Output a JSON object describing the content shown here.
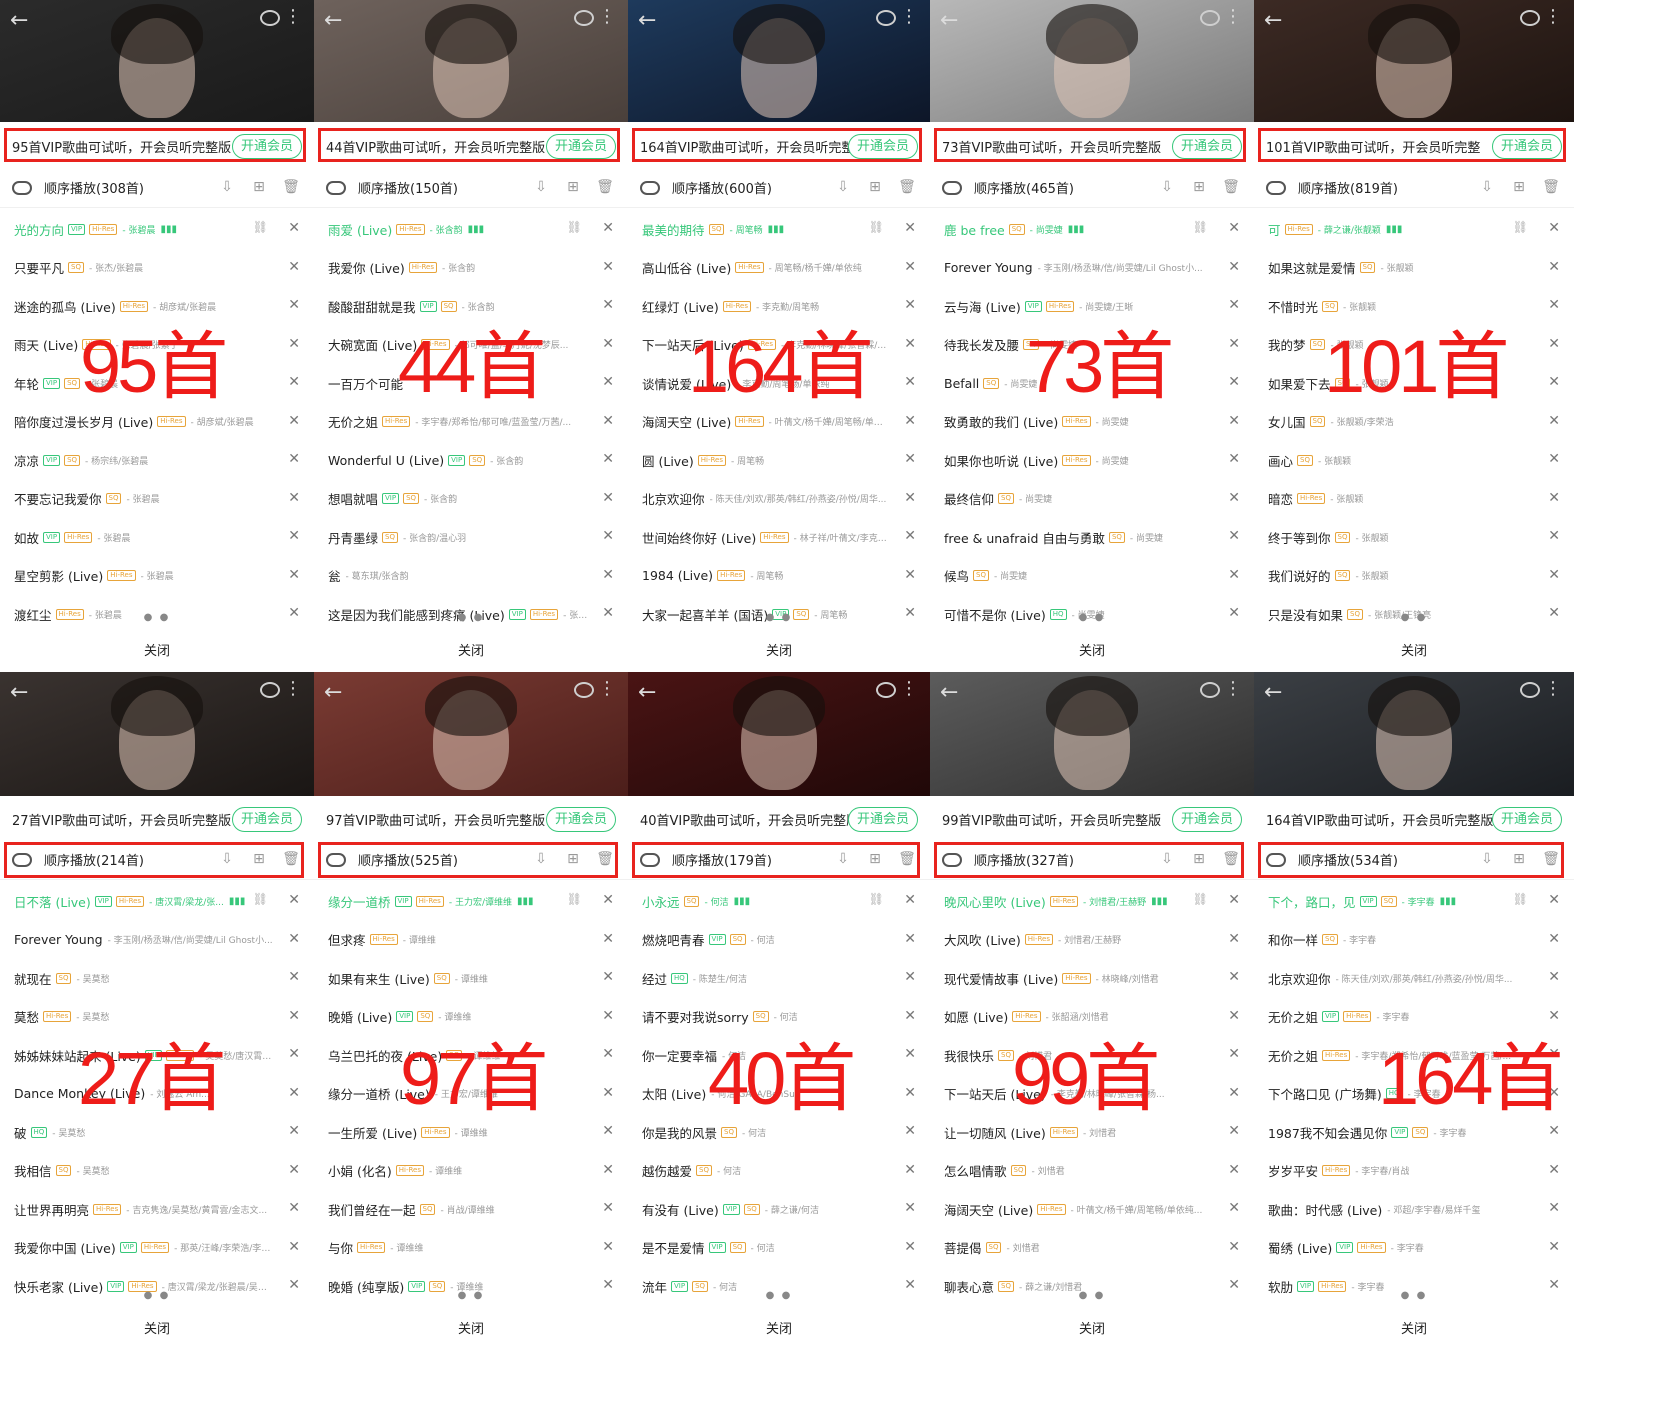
{
  "common": {
    "close_label": "关闭",
    "vip_button": "开通会员",
    "page_dots": "● ●",
    "icons": {
      "back": "back-arrow-icon",
      "comment": "comment-icon",
      "more": "more-icon",
      "shuffle": "loop-icon",
      "download": "download-icon",
      "add": "add-to-playlist-icon",
      "delete": "trash-icon",
      "link": "link-icon",
      "remove": "close-icon",
      "playing": "equalizer-icon"
    },
    "accent_color": "#37c77a",
    "highlight_color": "#ee1c19"
  },
  "panels": [
    {
      "vip_text": "95首VIP歌曲可试听，开会员听完整版",
      "play_label": "顺序播放(308首)",
      "big_label": "95首",
      "songs": [
        {
          "title": "光的方向",
          "tags": [
            "VIP",
            "Hi-Res"
          ],
          "artist": "张碧晨",
          "active": true
        },
        {
          "title": "只要平凡",
          "tags": [
            "SQ"
          ],
          "artist": "张杰/张碧晨"
        },
        {
          "title": "迷途的孤鸟 (Live)",
          "tags": [
            "Hi-Res"
          ],
          "artist": "胡彦斌/张碧晨"
        },
        {
          "title": "雨天 (Live)",
          "tags": [
            "Hi-Res"
          ],
          "artist": "张碧晨/张紫宁"
        },
        {
          "title": "年轮",
          "tags": [
            "VIP",
            "SQ"
          ],
          "artist": "张碧晨"
        },
        {
          "title": "陪你度过漫长岁月 (Live)",
          "tags": [
            "Hi-Res"
          ],
          "artist": "胡彦斌/张碧晨"
        },
        {
          "title": "凉凉",
          "tags": [
            "VIP",
            "SQ"
          ],
          "artist": "杨宗纬/张碧晨"
        },
        {
          "title": "不要忘记我爱你",
          "tags": [
            "SQ"
          ],
          "artist": "张碧晨"
        },
        {
          "title": "如故",
          "tags": [
            "VIP",
            "Hi-Res"
          ],
          "artist": "张碧晨"
        },
        {
          "title": "星空剪影 (Live)",
          "tags": [
            "Hi-Res"
          ],
          "artist": "张碧晨"
        },
        {
          "title": "渡红尘",
          "tags": [
            "Hi-Res"
          ],
          "artist": "张碧晨"
        }
      ]
    },
    {
      "vip_text": "44首VIP歌曲可试听，开会员听完整版",
      "play_label": "顺序播放(150首)",
      "big_label": "44首",
      "songs": [
        {
          "title": "雨爱 (Live)",
          "tags": [
            "Hi-Res"
          ],
          "artist": "张含韵",
          "active": true
        },
        {
          "title": "我爱你 (Live)",
          "tags": [
            "Hi-Res"
          ],
          "artist": "张含韵"
        },
        {
          "title": "酸酸甜甜就是我",
          "tags": [
            "VIP",
            "SQ"
          ],
          "artist": "张含韵"
        },
        {
          "title": "大碗宽面 (Live)",
          "tags": [
            "Hi-Res"
          ],
          "artist": "郁可唯/孟/李丹妮/沈梦辰..."
        },
        {
          "title": "一百万个可能",
          "tags": [],
          "artist": ""
        },
        {
          "title": "无价之姐",
          "tags": [
            "Hi-Res"
          ],
          "artist": "李宇春/郑希怡/郁可唯/蓝盈莹/万茜/..."
        },
        {
          "title": "Wonderful U (Live)",
          "tags": [
            "VIP",
            "SQ"
          ],
          "artist": "张含韵"
        },
        {
          "title": "想唱就唱",
          "tags": [
            "VIP",
            "SQ"
          ],
          "artist": "张含韵"
        },
        {
          "title": "丹青墨绿",
          "tags": [
            "SQ"
          ],
          "artist": "张含韵/温心羽"
        },
        {
          "title": "瓮",
          "tags": [],
          "artist": "葛东琪/张含韵"
        },
        {
          "title": "这是因为我们能感到疼痛 (Live)",
          "tags": [
            "VIP",
            "Hi-Res"
          ],
          "artist": "张含韵..."
        }
      ]
    },
    {
      "vip_text": "164首VIP歌曲可试听，开会员听完整版",
      "play_label": "顺序播放(600首)",
      "big_label": "164首",
      "songs": [
        {
          "title": "最美的期待",
          "tags": [
            "SQ"
          ],
          "artist": "周笔畅",
          "active": true
        },
        {
          "title": "高山低谷 (Live)",
          "tags": [
            "Hi-Res"
          ],
          "artist": "周笔畅/杨千嬅/单依纯"
        },
        {
          "title": "红绿灯 (Live)",
          "tags": [
            "Hi-Res"
          ],
          "artist": "李克勤/周笔畅"
        },
        {
          "title": "下一站天后 (Live)",
          "tags": [
            "Hi-Res"
          ],
          "artist": "李克勤/林晓峰/张智霖/杨..."
        },
        {
          "title": "谈情说爱 (Live)",
          "tags": [],
          "artist": "李克勤/周笔畅/单依纯"
        },
        {
          "title": "海阔天空 (Live)",
          "tags": [
            "Hi-Res"
          ],
          "artist": "叶蒨文/杨千嬅/周笔畅/单依纯..."
        },
        {
          "title": "圆 (Live)",
          "tags": [
            "Hi-Res"
          ],
          "artist": "周笔畅"
        },
        {
          "title": "北京欢迎你",
          "tags": [],
          "artist": "陈天佳/刘欢/那英/韩红/孙燕姿/孙悦/周华..."
        },
        {
          "title": "世间始终你好 (Live)",
          "tags": [
            "Hi-Res"
          ],
          "artist": "林子祥/叶蒨文/李克勤/..."
        },
        {
          "title": "1984 (Live)",
          "tags": [
            "Hi-Res"
          ],
          "artist": "周笔畅"
        },
        {
          "title": "大家一起喜羊羊 (国语)",
          "tags": [
            "VIP",
            "SQ"
          ],
          "artist": "周笔畅"
        }
      ]
    },
    {
      "vip_text": "73首VIP歌曲可试听，开会员听完整版",
      "play_label": "顺序播放(465首)",
      "big_label": "73首",
      "songs": [
        {
          "title": "鹿 be free",
          "tags": [
            "SQ"
          ],
          "artist": "尚雯婕",
          "active": true
        },
        {
          "title": "Forever Young",
          "tags": [],
          "artist": "李玉刚/杨丞琳/信/尚雯婕/Lil Ghost小..."
        },
        {
          "title": "云与海 (Live)",
          "tags": [
            "VIP",
            "Hi-Res"
          ],
          "artist": "尚雯婕/王晰"
        },
        {
          "title": "待我长发及腰",
          "tags": [
            "SQ"
          ],
          "artist": "尚雯婕"
        },
        {
          "title": "Befall",
          "tags": [
            "SQ"
          ],
          "artist": "尚雯婕"
        },
        {
          "title": "致勇敢的我们 (Live)",
          "tags": [
            "Hi-Res"
          ],
          "artist": "尚雯婕"
        },
        {
          "title": "如果你也听说 (Live)",
          "tags": [
            "Hi-Res"
          ],
          "artist": "尚雯婕"
        },
        {
          "title": "最终信仰",
          "tags": [
            "SQ"
          ],
          "artist": "尚雯婕"
        },
        {
          "title": "free & unafraid 自由与勇敢",
          "tags": [
            "SQ"
          ],
          "artist": "尚雯婕"
        },
        {
          "title": "候鸟",
          "tags": [
            "SQ"
          ],
          "artist": "尚雯婕"
        },
        {
          "title": "可惜不是你 (Live)",
          "tags": [
            "HQ"
          ],
          "artist": "尚雯婕"
        }
      ]
    },
    {
      "vip_text": "101首VIP歌曲可试听，开会员听完整",
      "play_label": "顺序播放(819首)",
      "big_label": "101首",
      "songs": [
        {
          "title": "可",
          "tags": [
            "Hi-Res"
          ],
          "artist": "薛之谦/张靓颖",
          "active": true
        },
        {
          "title": "如果这就是爱情",
          "tags": [
            "SQ"
          ],
          "artist": "张靓颖"
        },
        {
          "title": "不惜时光",
          "tags": [
            "SQ"
          ],
          "artist": "张靓颖"
        },
        {
          "title": "我的梦",
          "tags": [
            "SQ"
          ],
          "artist": "张靓颖"
        },
        {
          "title": "如果爱下去",
          "tags": [
            "SQ"
          ],
          "artist": "张靓颖"
        },
        {
          "title": "女儿国",
          "tags": [
            "SQ"
          ],
          "artist": "张靓颖/李荣浩"
        },
        {
          "title": "画心",
          "tags": [
            "SQ"
          ],
          "artist": "张靓颖"
        },
        {
          "title": "暗恋",
          "tags": [
            "Hi-Res"
          ],
          "artist": "张靓颖"
        },
        {
          "title": "终于等到你",
          "tags": [
            "SQ"
          ],
          "artist": "张靓颖"
        },
        {
          "title": "我们说好的",
          "tags": [
            "SQ"
          ],
          "artist": "张靓颖"
        },
        {
          "title": "只是没有如果",
          "tags": [
            "SQ"
          ],
          "artist": "张靓颖/王铮亮"
        }
      ]
    },
    {
      "vip_text": "27首VIP歌曲可试听，开会员听完整版",
      "play_label": "顺序播放(214首)",
      "big_label": "27首",
      "songs": [
        {
          "title": "日不落 (Live)",
          "tags": [
            "VIP",
            "Hi-Res"
          ],
          "artist": "唐汉霄/梁龙/张...",
          "active": true
        },
        {
          "title": "Forever Young",
          "tags": [],
          "artist": "李玉刚/杨丞琳/信/尚雯婕/Lil Ghost小..."
        },
        {
          "title": "就现在",
          "tags": [
            "SQ"
          ],
          "artist": "吴莫愁"
        },
        {
          "title": "莫愁",
          "tags": [
            "Hi-Res"
          ],
          "artist": "吴莫愁"
        },
        {
          "title": "姊姊妹妹站起来 (Live)",
          "tags": [
            "VIP",
            "Hi-Res"
          ],
          "artist": "吴莫愁/唐汉霄/梁..."
        },
        {
          "title": "Dance Monkey (Live)",
          "tags": [],
          "artist": "刘逸云 Am..."
        },
        {
          "title": "破",
          "tags": [
            "HQ"
          ],
          "artist": "吴莫愁"
        },
        {
          "title": "我相信",
          "tags": [
            "SQ"
          ],
          "artist": "吴莫愁"
        },
        {
          "title": "让世界再明亮",
          "tags": [
            "Hi-Res"
          ],
          "artist": "吉克隽逸/吴莫愁/黄霄雲/金志文..."
        },
        {
          "title": "我爱你中国 (Live)",
          "tags": [
            "VIP",
            "Hi-Res"
          ],
          "artist": "那英/汪峰/李荣浩/李克..."
        },
        {
          "title": "快乐老家 (Live)",
          "tags": [
            "VIP",
            "Hi-Res"
          ],
          "artist": "唐汉霄/梁龙/张碧晨/吴莫..."
        }
      ]
    },
    {
      "vip_text": "97首VIP歌曲可试听，开会员听完整版",
      "play_label": "顺序播放(525首)",
      "big_label": "97首",
      "songs": [
        {
          "title": "缘分一道桥",
          "tags": [
            "VIP",
            "Hi-Res"
          ],
          "artist": "王力宏/谭维维",
          "active": true
        },
        {
          "title": "但求疼",
          "tags": [
            "Hi-Res"
          ],
          "artist": "谭维维"
        },
        {
          "title": "如果有来生 (Live)",
          "tags": [
            "SQ"
          ],
          "artist": "谭维维"
        },
        {
          "title": "晚婚 (Live)",
          "tags": [
            "VIP",
            "SQ"
          ],
          "artist": "谭维维"
        },
        {
          "title": "乌兰巴托的夜 (Live)",
          "tags": [
            "SQ"
          ],
          "artist": "谭维维"
        },
        {
          "title": "缘分一道桥 (Live)",
          "tags": [],
          "artist": "王力宏/谭维维"
        },
        {
          "title": "一生所爱 (Live)",
          "tags": [
            "Hi-Res"
          ],
          "artist": "谭维维"
        },
        {
          "title": "小娟 (化名)",
          "tags": [
            "Hi-Res"
          ],
          "artist": "谭维维"
        },
        {
          "title": "我们曾经在一起",
          "tags": [
            "SQ"
          ],
          "artist": "肖战/谭维维"
        },
        {
          "title": "与你",
          "tags": [
            "Hi-Res"
          ],
          "artist": "谭维维"
        },
        {
          "title": "晚婚 (纯享版)",
          "tags": [
            "VIP",
            "SQ"
          ],
          "artist": "谭维维"
        }
      ]
    },
    {
      "vip_text": "40首VIP歌曲可试听，开会员听完整版",
      "play_label": "顺序播放(179首)",
      "big_label": "40首",
      "songs": [
        {
          "title": "小永远",
          "tags": [
            "SQ"
          ],
          "artist": "何洁",
          "active": true
        },
        {
          "title": "燃烧吧青春",
          "tags": [
            "VIP",
            "SQ"
          ],
          "artist": "何洁"
        },
        {
          "title": "经过",
          "tags": [
            "HQ"
          ],
          "artist": "陈楚生/何洁"
        },
        {
          "title": "请不要对我说sorry",
          "tags": [
            "SQ"
          ],
          "artist": "何洁"
        },
        {
          "title": "你一定要幸福",
          "tags": [],
          "artist": "何洁"
        },
        {
          "title": "太阳 (Live)",
          "tags": [],
          "artist": "何洁/GALA/BenSu"
        },
        {
          "title": "你是我的风景",
          "tags": [
            "SQ"
          ],
          "artist": "何洁"
        },
        {
          "title": "越伤越爱",
          "tags": [
            "SQ"
          ],
          "artist": "何洁"
        },
        {
          "title": "有没有 (Live)",
          "tags": [
            "VIP",
            "SQ"
          ],
          "artist": "薛之谦/何洁"
        },
        {
          "title": "是不是爱情",
          "tags": [
            "VIP",
            "SQ"
          ],
          "artist": "何洁"
        },
        {
          "title": "流年",
          "tags": [
            "VIP",
            "SQ"
          ],
          "artist": "何洁"
        }
      ]
    },
    {
      "vip_text": "99首VIP歌曲可试听，开会员听完整版",
      "play_label": "顺序播放(327首)",
      "big_label": "99首",
      "songs": [
        {
          "title": "晚风心里吹 (Live)",
          "tags": [
            "Hi-Res"
          ],
          "artist": "刘惜君/王赫野",
          "active": true
        },
        {
          "title": "大风吹 (Live)",
          "tags": [
            "Hi-Res"
          ],
          "artist": "刘惜君/王赫野"
        },
        {
          "title": "现代爱情故事 (Live)",
          "tags": [
            "Hi-Res"
          ],
          "artist": "林晓峰/刘惜君"
        },
        {
          "title": "如愿 (Live)",
          "tags": [
            "Hi-Res"
          ],
          "artist": "张韶涵/刘惜君"
        },
        {
          "title": "我很快乐",
          "tags": [
            "SQ"
          ],
          "artist": "刘惜君"
        },
        {
          "title": "下一站天后 (Live)",
          "tags": [],
          "artist": "李克勤/林晓峰/张智霖/杨..."
        },
        {
          "title": "让一切随风 (Live)",
          "tags": [
            "Hi-Res"
          ],
          "artist": "刘惜君"
        },
        {
          "title": "怎么唱情歌",
          "tags": [
            "SQ"
          ],
          "artist": "刘惜君"
        },
        {
          "title": "海阔天空 (Live)",
          "tags": [
            "Hi-Res"
          ],
          "artist": "叶蒨文/杨千嬅/周笔畅/单依纯..."
        },
        {
          "title": "菩提偈",
          "tags": [
            "SQ"
          ],
          "artist": "刘惜君"
        },
        {
          "title": "聊表心意",
          "tags": [
            "SQ"
          ],
          "artist": "薛之谦/刘惜君"
        }
      ]
    },
    {
      "vip_text": "164首VIP歌曲可试听，开会员听完整版",
      "play_label": "顺序播放(534首)",
      "big_label": "164首",
      "songs": [
        {
          "title": "下个，路口，见",
          "tags": [
            "VIP",
            "SQ"
          ],
          "artist": "李宇春",
          "active": true
        },
        {
          "title": "和你一样",
          "tags": [
            "SQ"
          ],
          "artist": "李宇春"
        },
        {
          "title": "北京欢迎你",
          "tags": [],
          "artist": "陈天佳/刘欢/那英/韩红/孙燕姿/孙悦/周华..."
        },
        {
          "title": "无价之姐",
          "tags": [
            "VIP",
            "Hi-Res"
          ],
          "artist": "李宇春"
        },
        {
          "title": "无价之姐",
          "tags": [
            "Hi-Res"
          ],
          "artist": "李宇春/郑希怡/郁可唯/蓝盈莹/万茜/..."
        },
        {
          "title": "下个路口见 (广场舞)",
          "tags": [
            "HQ"
          ],
          "artist": "李宇春"
        },
        {
          "title": "1987我不知会遇见你",
          "tags": [
            "VIP",
            "SQ"
          ],
          "artist": "李宇春"
        },
        {
          "title": "岁岁平安",
          "tags": [
            "Hi-Res"
          ],
          "artist": "李宇春/肖战"
        },
        {
          "title": "歌曲：时代感 (Live)",
          "tags": [],
          "artist": "邓超/李宇春/易烊千玺"
        },
        {
          "title": "蜀绣 (Live)",
          "tags": [
            "VIP",
            "Hi-Res"
          ],
          "artist": "李宇春"
        },
        {
          "title": "软肋",
          "tags": [
            "VIP",
            "Hi-Res"
          ],
          "artist": "李宇春"
        }
      ]
    }
  ]
}
